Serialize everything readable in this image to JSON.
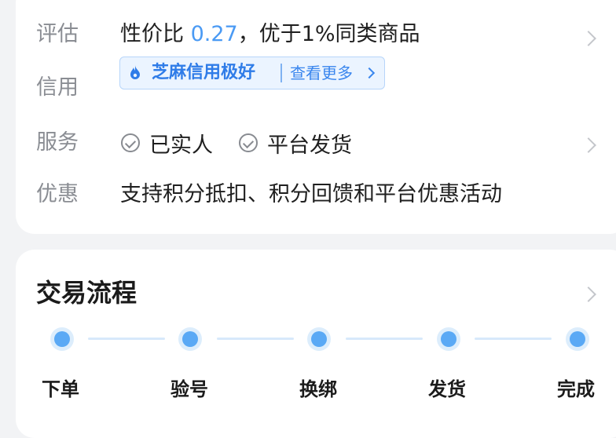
{
  "details": {
    "eval": {
      "label": "评估",
      "prefix": "性价比 ",
      "value": "0.27",
      "suffix": "，优于1%同类商品"
    },
    "credit": {
      "label": "信用",
      "badge": "芝麻信用极好",
      "link": "查看更多"
    },
    "service": {
      "label": "服务",
      "items": [
        "已实人",
        "平台发货"
      ]
    },
    "discount": {
      "label": "优惠",
      "text": "支持积分抵扣、积分回馈和平台优惠活动"
    }
  },
  "process": {
    "title": "交易流程",
    "steps": [
      "下单",
      "验号",
      "换绑",
      "发货",
      "完成"
    ]
  },
  "colors": {
    "accent": "#4a9af4",
    "badge_bg": "#ebf4ff",
    "step_dot": "#5aa9f5"
  }
}
